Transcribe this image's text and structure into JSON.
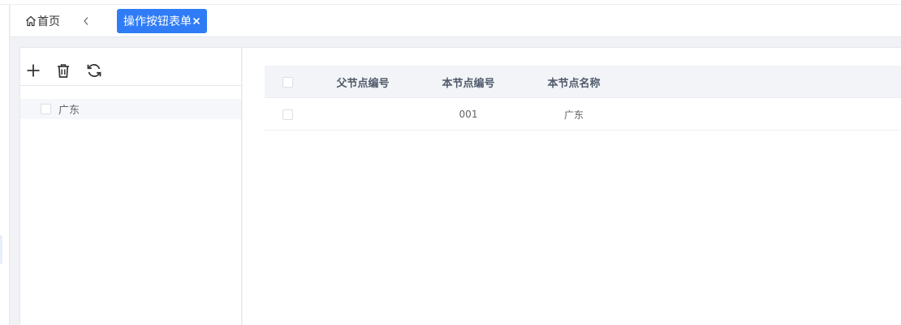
{
  "tabs": {
    "home_label": "首页",
    "active_label": "操作按钮表单"
  },
  "tree": {
    "toolbar": [
      "plus-icon",
      "trash-icon",
      "refresh-icon"
    ],
    "nodes": [
      {
        "label": "广东"
      }
    ]
  },
  "table": {
    "columns": [
      "父节点编号",
      "本节点编号",
      "本节点名称"
    ],
    "rows": [
      {
        "parent": "",
        "code": "001",
        "name": "广东"
      }
    ]
  },
  "colors": {
    "accent": "#2f7cf6",
    "header_bg": "#f2f4f7",
    "selected_row": "#f5f7fa"
  }
}
